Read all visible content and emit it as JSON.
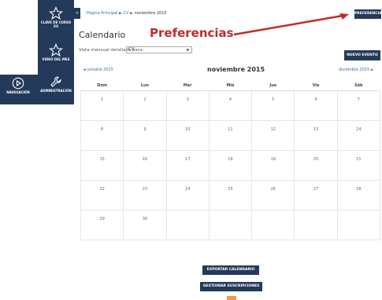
{
  "nav": {
    "items": [
      {
        "label": "CLAVE DE CURSO XX"
      },
      {
        "label": "VIDEO DEL MES"
      },
      {
        "label": "NAVEGACIÓN"
      },
      {
        "label": "ADMINISTRACIÓN"
      }
    ],
    "collapse_label": "«"
  },
  "breadcrumb": {
    "home": "Página Principal",
    "sep1": "►",
    "cv": "CV",
    "sep2": "►",
    "current": "noviembre 2015"
  },
  "header": {
    "preferences_button": "PREFERENCIAS"
  },
  "annotation": {
    "label": "Preferencias"
  },
  "calendar": {
    "title": "Calendario",
    "view_label": "Vista mensual detallada para:",
    "view_value": "CV",
    "new_event_button": "NUEVO EVENTO",
    "prev_month": "◄ octubre 2015",
    "month": "noviembre 2015",
    "next_month": "diciembre 2015 ►",
    "weekdays": [
      "Dom",
      "Lun",
      "Mar",
      "Mié",
      "Jue",
      "Vie",
      "Sáb"
    ],
    "weeks": [
      [
        "1",
        "2",
        "3",
        "4",
        "5",
        "6",
        "7"
      ],
      [
        "8",
        "9",
        "10",
        "11",
        "12",
        "13",
        "14"
      ],
      [
        "15",
        "16",
        "17",
        "18",
        "19",
        "20",
        "21"
      ],
      [
        "22",
        "23",
        "24",
        "25",
        "26",
        "27",
        "28"
      ],
      [
        "29",
        "30",
        "",
        "",
        "",
        "",
        ""
      ]
    ]
  },
  "footer": {
    "export_button": "EXPORTAR CALENDARIO",
    "manage_button": "GESTIONAR SUSCRIPCIONES"
  },
  "colors": {
    "nav_bg": "#243a5a",
    "annotation": "#c22a2a",
    "link": "#3a6aa8"
  }
}
